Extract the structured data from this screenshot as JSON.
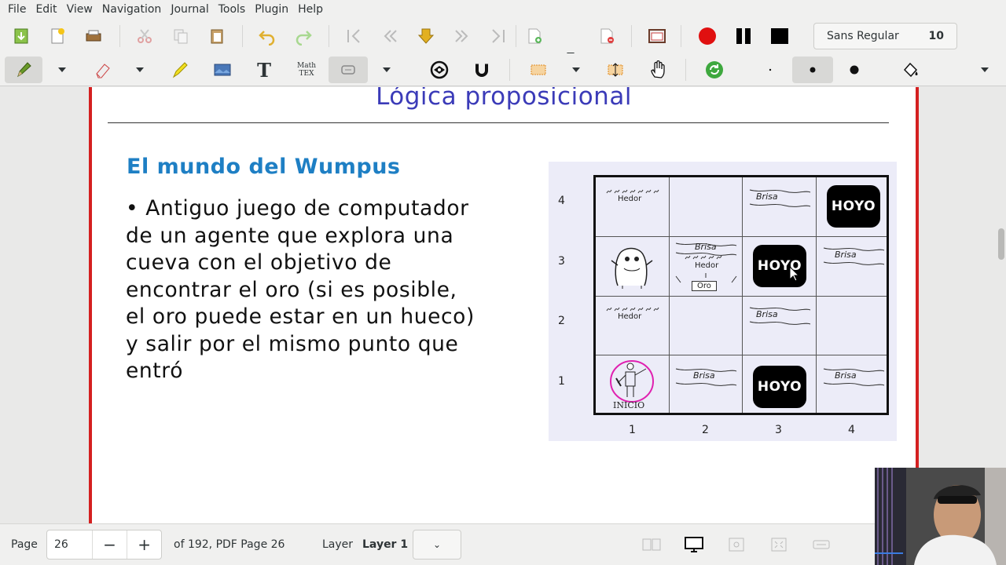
{
  "menu": [
    "File",
    "Edit",
    "View",
    "Navigation",
    "Journal",
    "Tools",
    "Plugin",
    "Help"
  ],
  "toolbar": {
    "font_name": "Sans Regular",
    "font_size": "10",
    "tex_label_top": "Math",
    "tex_label_bottom": "TEX"
  },
  "slide": {
    "title": "Lógica proposicional",
    "subtitle": "El mundo del Wumpus",
    "body_lines": [
      "• Antiguo juego de computador",
      "de un agente que explora una",
      "cueva con el objetivo de",
      "encontrar el oro (si es posible,",
      "el oro puede estar en un hueco)",
      "y salir por el mismo punto que",
      "entró"
    ],
    "figure": {
      "row_labels": [
        "4",
        "3",
        "2",
        "1"
      ],
      "col_labels": [
        "1",
        "2",
        "3",
        "4"
      ],
      "hoyo": "HOYO",
      "brisa": "Brisa",
      "hedor": "Hedor",
      "oro": "Oro",
      "inicio": "INICIO"
    }
  },
  "status": {
    "page_label": "Page",
    "page_value": "26",
    "minus": "−",
    "plus": "+",
    "page_of": "of 192, PDF Page 26",
    "layer_label": "Layer",
    "layer_value": "Layer 1",
    "layer_dropdown": "⌄"
  },
  "colors": {
    "title": "#3b3bb8",
    "subtitle": "#1e7fc4",
    "page_border": "#d42020",
    "record": "#e01010"
  }
}
